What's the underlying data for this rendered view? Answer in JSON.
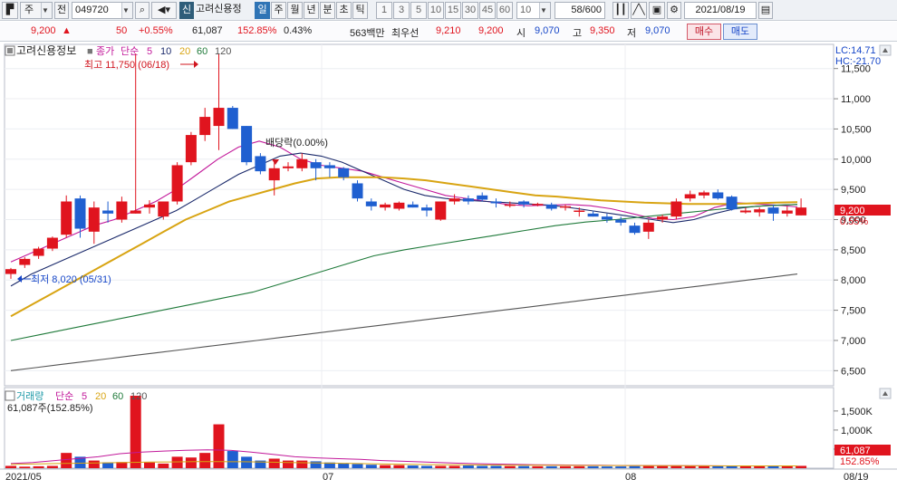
{
  "toolbar": {
    "market": "주",
    "prev_label": "전",
    "code": "049720",
    "badge": "신",
    "stock_name": "고려신용정",
    "periods": [
      "일",
      "주",
      "월",
      "년",
      "분",
      "초",
      "틱"
    ],
    "active_period": "일",
    "minutes": [
      "1",
      "3",
      "5",
      "10",
      "15",
      "30",
      "45",
      "60"
    ],
    "min_select": "10",
    "count": "58/600",
    "date": "2021/08/19"
  },
  "quote": {
    "price": "9,200",
    "arrow": "▲",
    "change": "50",
    "change_pct": "+0.55%",
    "volume": "61,087",
    "volume_ratio": "152.85%",
    "turnover": "0.43%",
    "amount": "563백만",
    "best_label": "최우선",
    "best_ask": "9,210",
    "best_bid": "9,200",
    "open_label": "시",
    "open": "9,070",
    "high_label": "고",
    "high": "9,350",
    "low_label": "저",
    "low": "9,070",
    "buy_label": "매수",
    "sell_label": "매도"
  },
  "chart_data": {
    "type": "candlestick",
    "title": "고려신용정보",
    "legend": {
      "close_label": "종가",
      "ma_label": "단순",
      "ma_periods": [
        "5",
        "10",
        "20",
        "60",
        "120"
      ],
      "ma_colors": [
        "#c2189a",
        "#1b2a6b",
        "#d8a412",
        "#1f7a3a",
        "#555555"
      ]
    },
    "y_axis": {
      "ticks": [
        11500,
        11000,
        10500,
        10000,
        9500,
        9000,
        8500,
        8000,
        7500,
        7000,
        6500
      ],
      "tick_labels": [
        "11,500",
        "11,000",
        "10,500",
        "10,000",
        "9,500",
        "9,000",
        "8,500",
        "8,000",
        "7,500",
        "7,000",
        "6,500"
      ],
      "range": [
        6250,
        11900
      ],
      "lc": "LC:14.71",
      "hc": "HC:-21.70",
      "current_label": "9,200",
      "current_pct": "0.55%"
    },
    "annotations": {
      "high": "최고 11,750 (06/18)",
      "low": "최저 8,020 (05/31)",
      "dividend": "배당락(0.00%)"
    },
    "x_labels": [
      "2021/05",
      "07",
      "08",
      "08/19"
    ],
    "candles": [
      {
        "o": 8100,
        "h": 8200,
        "l": 8020,
        "c": 8180
      },
      {
        "o": 8250,
        "h": 8380,
        "l": 8200,
        "c": 8350
      },
      {
        "o": 8400,
        "h": 8550,
        "l": 8350,
        "c": 8520
      },
      {
        "o": 8520,
        "h": 8720,
        "l": 8480,
        "c": 8700
      },
      {
        "o": 8750,
        "h": 9400,
        "l": 8700,
        "c": 9300
      },
      {
        "o": 9350,
        "h": 9400,
        "l": 8700,
        "c": 8850
      },
      {
        "o": 8800,
        "h": 9300,
        "l": 8600,
        "c": 9200
      },
      {
        "o": 9150,
        "h": 9300,
        "l": 8950,
        "c": 9100
      },
      {
        "o": 9000,
        "h": 9380,
        "l": 8950,
        "c": 9300
      },
      {
        "o": 9100,
        "h": 11750,
        "l": 9100,
        "c": 9150
      },
      {
        "o": 9200,
        "h": 9320,
        "l": 9100,
        "c": 9250
      },
      {
        "o": 9050,
        "h": 9300,
        "l": 9000,
        "c": 9300
      },
      {
        "o": 9300,
        "h": 9950,
        "l": 9250,
        "c": 9900
      },
      {
        "o": 9950,
        "h": 10450,
        "l": 9900,
        "c": 10400
      },
      {
        "o": 10400,
        "h": 10850,
        "l": 10300,
        "c": 10700
      },
      {
        "o": 10550,
        "h": 11750,
        "l": 10150,
        "c": 10850
      },
      {
        "o": 10850,
        "h": 10880,
        "l": 10500,
        "c": 10500
      },
      {
        "o": 10550,
        "h": 10550,
        "l": 9900,
        "c": 9950
      },
      {
        "o": 10050,
        "h": 10100,
        "l": 9750,
        "c": 9800
      },
      {
        "o": 9650,
        "h": 9950,
        "l": 9400,
        "c": 9850
      },
      {
        "o": 9850,
        "h": 9950,
        "l": 9800,
        "c": 9880
      },
      {
        "o": 9850,
        "h": 10100,
        "l": 9800,
        "c": 10000
      },
      {
        "o": 9950,
        "h": 10000,
        "l": 9650,
        "c": 9850
      },
      {
        "o": 9900,
        "h": 9950,
        "l": 9700,
        "c": 9850
      },
      {
        "o": 9850,
        "h": 9870,
        "l": 9650,
        "c": 9700
      },
      {
        "o": 9600,
        "h": 9650,
        "l": 9300,
        "c": 9350
      },
      {
        "o": 9300,
        "h": 9350,
        "l": 9150,
        "c": 9220
      },
      {
        "o": 9200,
        "h": 9280,
        "l": 9150,
        "c": 9250
      },
      {
        "o": 9180,
        "h": 9300,
        "l": 9150,
        "c": 9280
      },
      {
        "o": 9250,
        "h": 9300,
        "l": 9200,
        "c": 9200
      },
      {
        "o": 9200,
        "h": 9250,
        "l": 9050,
        "c": 9150
      },
      {
        "o": 9000,
        "h": 9300,
        "l": 8980,
        "c": 9300
      },
      {
        "o": 9300,
        "h": 9420,
        "l": 9250,
        "c": 9350
      },
      {
        "o": 9350,
        "h": 9400,
        "l": 9250,
        "c": 9300
      },
      {
        "o": 9400,
        "h": 9450,
        "l": 9300,
        "c": 9330
      },
      {
        "o": 9300,
        "h": 9350,
        "l": 9200,
        "c": 9270
      },
      {
        "o": 9250,
        "h": 9300,
        "l": 9200,
        "c": 9250
      },
      {
        "o": 9300,
        "h": 9320,
        "l": 9200,
        "c": 9250
      },
      {
        "o": 9250,
        "h": 9280,
        "l": 9220,
        "c": 9260
      },
      {
        "o": 9250,
        "h": 9280,
        "l": 9150,
        "c": 9180
      },
      {
        "o": 9200,
        "h": 9250,
        "l": 9150,
        "c": 9220
      },
      {
        "o": 9150,
        "h": 9200,
        "l": 9050,
        "c": 9150
      },
      {
        "o": 9100,
        "h": 9150,
        "l": 9050,
        "c": 9050
      },
      {
        "o": 9050,
        "h": 9100,
        "l": 8950,
        "c": 9000
      },
      {
        "o": 9000,
        "h": 9050,
        "l": 8900,
        "c": 8950
      },
      {
        "o": 8900,
        "h": 8950,
        "l": 8750,
        "c": 8780
      },
      {
        "o": 8800,
        "h": 9000,
        "l": 8680,
        "c": 8950
      },
      {
        "o": 9000,
        "h": 9080,
        "l": 8950,
        "c": 9050
      },
      {
        "o": 9050,
        "h": 9350,
        "l": 9000,
        "c": 9300
      },
      {
        "o": 9350,
        "h": 9480,
        "l": 9300,
        "c": 9420
      },
      {
        "o": 9400,
        "h": 9480,
        "l": 9350,
        "c": 9450
      },
      {
        "o": 9450,
        "h": 9500,
        "l": 9330,
        "c": 9350
      },
      {
        "o": 9380,
        "h": 9400,
        "l": 9150,
        "c": 9170
      },
      {
        "o": 9120,
        "h": 9200,
        "l": 9100,
        "c": 9150
      },
      {
        "o": 9120,
        "h": 9200,
        "l": 9050,
        "c": 9170
      },
      {
        "o": 9200,
        "h": 9250,
        "l": 8980,
        "c": 9100
      },
      {
        "o": 9100,
        "h": 9220,
        "l": 9050,
        "c": 9150
      },
      {
        "o": 9070,
        "h": 9350,
        "l": 9070,
        "c": 9200
      }
    ],
    "ma": {
      "ma5": [
        8300,
        8450,
        8600,
        8750,
        8900,
        9000,
        9150,
        9300,
        9500,
        9750,
        10000,
        10200,
        10300,
        10200,
        10000,
        9900,
        9850,
        9800,
        9700,
        9600,
        9500,
        9400,
        9350,
        9300,
        9250,
        9230,
        9240,
        9250,
        9230,
        9180,
        9100,
        9020,
        9000,
        9050,
        9200,
        9280,
        9260,
        9240,
        9210
      ],
      "ma10": [
        7900,
        8100,
        8250,
        8400,
        8550,
        8700,
        8850,
        9000,
        9150,
        9350,
        9550,
        9750,
        9900,
        10050,
        10100,
        10050,
        9950,
        9800,
        9650,
        9500,
        9400,
        9350,
        9320,
        9300,
        9280,
        9260,
        9240,
        9200,
        9150,
        9100,
        9050,
        9000,
        8950,
        9000,
        9100,
        9180,
        9220,
        9240,
        9250
      ],
      "ma20": [
        7400,
        7600,
        7800,
        8000,
        8200,
        8400,
        8600,
        8800,
        9000,
        9150,
        9300,
        9400,
        9500,
        9600,
        9680,
        9700,
        9700,
        9700,
        9680,
        9650,
        9600,
        9550,
        9500,
        9450,
        9400,
        9380,
        9350,
        9320,
        9300,
        9280,
        9270,
        9260,
        9260,
        9260,
        9270,
        9280,
        9290
      ],
      "ma60": [
        7000,
        7100,
        7200,
        7300,
        7400,
        7500,
        7600,
        7700,
        7800,
        7950,
        8100,
        8250,
        8400,
        8500,
        8580,
        8660,
        8740,
        8820,
        8900,
        8960,
        9000,
        9050,
        9100,
        9150,
        9200,
        9230,
        9250
      ],
      "ma120": [
        6500,
        6550,
        6600,
        6650,
        6700,
        6750,
        6800,
        6850,
        6900,
        6950,
        7000,
        7050,
        7100,
        7150,
        7200,
        7250,
        7300,
        7350,
        7400,
        7450,
        7500,
        7550,
        7600,
        7650,
        7700,
        7750,
        7800,
        7850,
        7900,
        7950,
        8000,
        8050,
        8100
      ]
    },
    "volume_panel": {
      "title": "거래량",
      "ma_label": "단순",
      "ma_periods": [
        "5",
        "20",
        "60",
        "120"
      ],
      "summary": "61,087주(152.85%)",
      "ticks": [
        "1,500K",
        "1,000K",
        "500K"
      ],
      "range": [
        0,
        1900000
      ],
      "current_label": "61,087",
      "current_pct": "152.85%",
      "values": [
        60,
        40,
        50,
        60,
        400,
        300,
        200,
        150,
        160,
        1900,
        150,
        120,
        300,
        280,
        400,
        1150,
        450,
        300,
        200,
        250,
        200,
        200,
        180,
        150,
        120,
        110,
        90,
        80,
        80,
        70,
        60,
        60,
        60,
        70,
        60,
        60,
        55,
        55,
        50,
        50,
        50,
        50,
        50,
        45,
        45,
        55,
        60,
        70,
        70,
        65,
        60,
        60,
        55,
        55,
        55,
        55,
        55,
        61
      ]
    }
  }
}
